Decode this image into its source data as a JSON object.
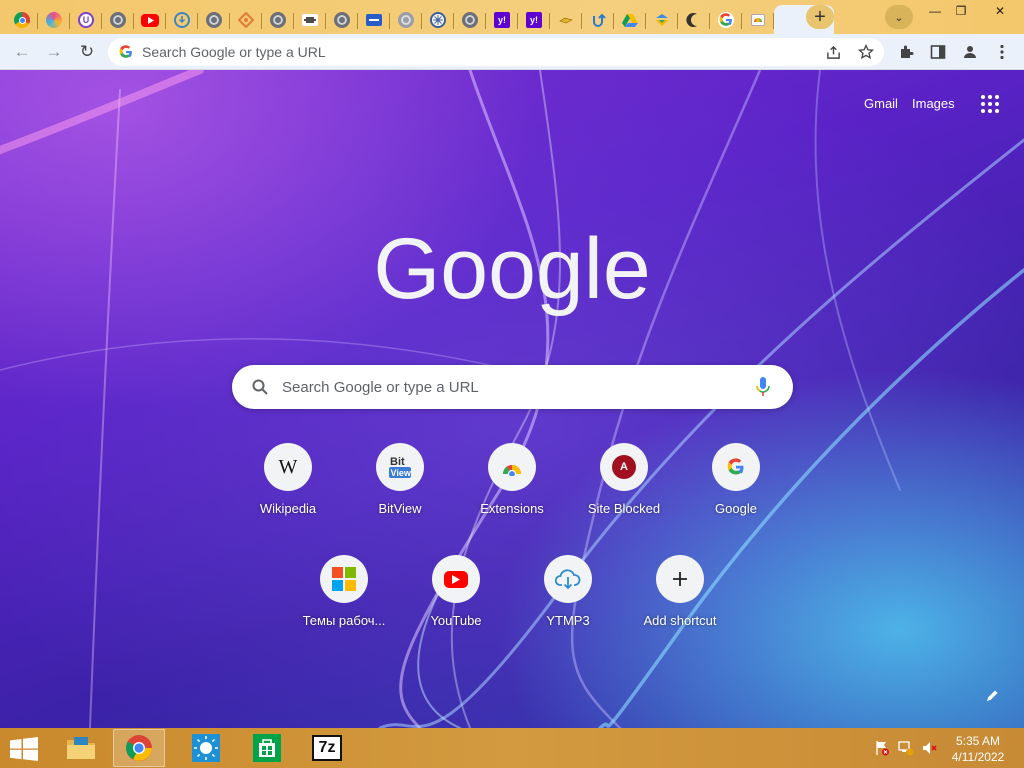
{
  "window": {
    "tabs": [
      {
        "icon": "chrome-icon"
      },
      {
        "icon": "colorful-ball-icon"
      },
      {
        "icon": "u-letter-icon",
        "glyph": "U"
      },
      {
        "icon": "globe-icon"
      },
      {
        "icon": "youtube-icon"
      },
      {
        "icon": "cloud-download-icon"
      },
      {
        "icon": "globe-icon"
      },
      {
        "icon": "orange-diamond-icon"
      },
      {
        "icon": "globe-icon"
      },
      {
        "icon": "stripe-logo-icon"
      },
      {
        "icon": "globe-icon"
      },
      {
        "icon": "blue-tv-icon"
      },
      {
        "icon": "globe-icon"
      },
      {
        "icon": "circle-grid-icon"
      },
      {
        "icon": "globe-icon"
      },
      {
        "icon": "yahoo-icon",
        "glyph": "y!"
      },
      {
        "icon": "yahoo-icon",
        "glyph": "y!"
      },
      {
        "icon": "yellow-tag-icon"
      },
      {
        "icon": "blue-arrow-icon"
      },
      {
        "icon": "google-drive-icon"
      },
      {
        "icon": "colorful-arrow-icon"
      },
      {
        "icon": "crescent-icon"
      },
      {
        "icon": "google-icon"
      },
      {
        "icon": "photos-icon"
      },
      {
        "icon": "new-tab-page-icon",
        "active": true
      }
    ],
    "new_tab_label": "+",
    "tab_search_label": "⌄",
    "minimize_label": "—",
    "restore_label": "❐",
    "close_label": "✕",
    "tab_close_label": "✕"
  },
  "toolbar": {
    "back_label": "←",
    "forward_label": "→",
    "reload_label": "↻",
    "omnibox_placeholder": "Search Google or type a URL"
  },
  "page": {
    "gmail_label": "Gmail",
    "images_label": "Images",
    "logo_text": "Google",
    "search_placeholder": "Search Google or type a URL",
    "shortcuts": [
      {
        "label": "Wikipedia",
        "icon": "wikipedia-icon"
      },
      {
        "label": "BitView",
        "icon": "bitview-icon"
      },
      {
        "label": "Extensions",
        "icon": "chrome-web-store-icon"
      },
      {
        "label": "Site Blocked",
        "icon": "site-blocked-icon"
      },
      {
        "label": "Google",
        "icon": "google-icon"
      },
      {
        "label": "Темы рабоч...",
        "icon": "microsoft-icon"
      },
      {
        "label": "YouTube",
        "icon": "youtube-icon"
      },
      {
        "label": "YTMP3",
        "icon": "cloud-download-icon"
      },
      {
        "label": "Add shortcut",
        "icon": "plus-icon"
      }
    ]
  },
  "taskbar": {
    "apps": [
      "file-explorer-icon",
      "chrome-icon",
      "weather-icon",
      "store-icon",
      "7zip-icon"
    ],
    "zip_label": "7z",
    "time": "5:35 AM",
    "date": "4/11/2022"
  },
  "colors": {
    "titlebar": "#f3c76b",
    "toolbar": "#eaf1fb",
    "taskbar": "#c9892c",
    "page_accent": "#5a22c6"
  }
}
